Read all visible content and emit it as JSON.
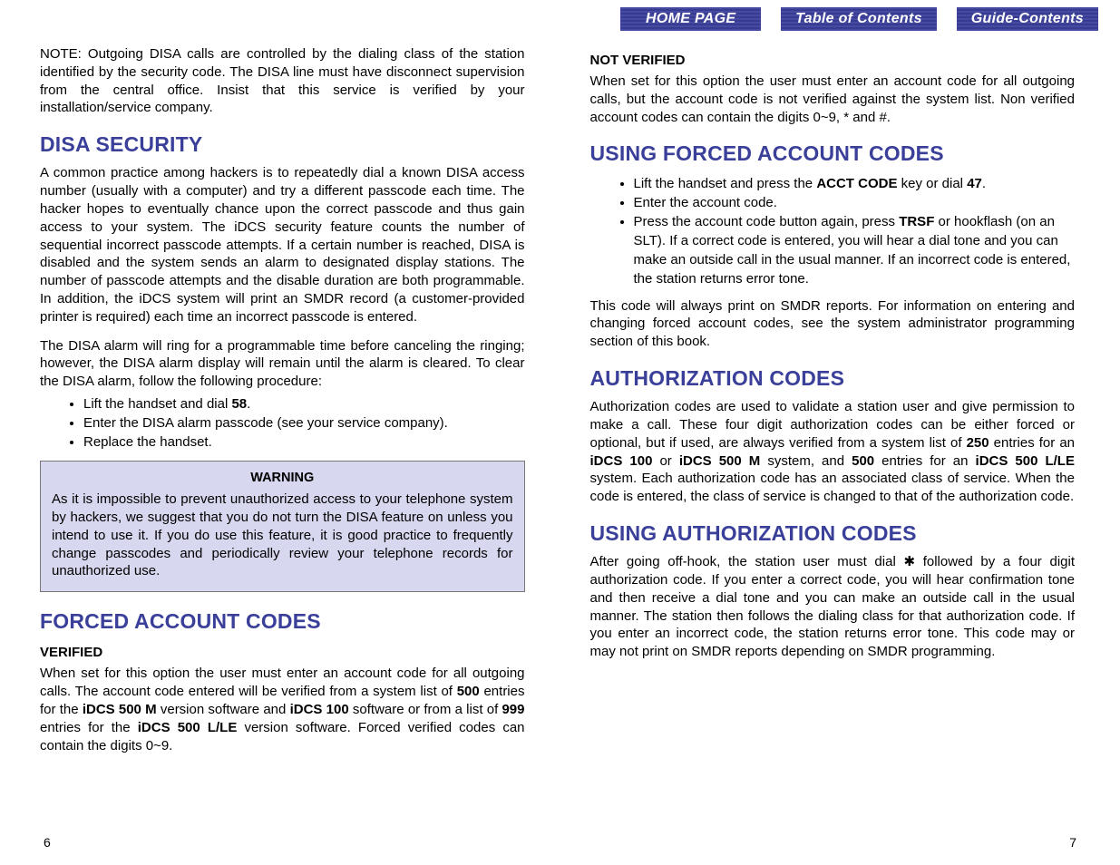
{
  "nav": {
    "home": "HOME PAGE",
    "toc": "Table of Contents",
    "guide": "Guide-Contents"
  },
  "left": {
    "note": "NOTE: Outgoing DISA calls are controlled by the dialing class of the station identified by the security code. The DISA line must have disconnect supervision from the central office. Insist that this service is verified by your installation/service company.",
    "h_disa": "DISA SECURITY",
    "disa_p1": "A common practice among hackers is to repeatedly dial a known DISA access number (usually with a computer) and try a different passcode each time. The hacker hopes to eventually chance upon the correct passcode and thus gain access to your system. The iDCS security feature counts the number of sequential incorrect passcode attempts. If a certain number is reached, DISA is disabled and the system sends an alarm to designated display stations. The number of passcode attempts and the disable duration are both programmable. In addition, the iDCS system will print an SMDR record (a customer-provided printer is required) each time an incorrect passcode is entered.",
    "disa_p2": "The DISA alarm will ring for a programmable time before canceling the ringing; however, the DISA alarm display will remain until the alarm is cleared. To clear the DISA alarm, follow the following procedure:",
    "disa_steps": {
      "s1a": "Lift the handset and dial ",
      "s1b": "58",
      "s1c": ".",
      "s2": "Enter the DISA alarm passcode (see your service company).",
      "s3": "Replace the handset."
    },
    "warn_title": "WARNING",
    "warn_body": "As it is impossible to prevent unauthorized access to your telephone system by hackers, we suggest that you do not turn the DISA feature on unless you intend to use it. If you do use this feature, it is good practice to frequently change passcodes and periodically review your telephone records for unauthorized use.",
    "h_forced": "FORCED ACCOUNT CODES",
    "h_verified": "VERIFIED",
    "verified_a": "When set for this option the user must enter an account code for all outgoing calls. The account code entered will be verified from a system list of ",
    "verified_b": "500",
    "verified_c": " entries for the ",
    "verified_d": "iDCS 500 M",
    "verified_e": " version software and ",
    "verified_f": "iDCS 100",
    "verified_g": " software or from a list of ",
    "verified_h": "999",
    "verified_i": " entries for the ",
    "verified_j": "iDCS 500 L/LE",
    "verified_k": " version software. Forced verified codes can contain the digits 0~9."
  },
  "right": {
    "h_notverified": "NOT VERIFIED",
    "notverified_p": "When set for this option the user must enter an account code for all outgoing calls, but the account code is not verified against the system list. Non verified account codes can contain the digits 0~9, * and #.",
    "h_usingforced": "USING FORCED ACCOUNT CODES",
    "uf_s1a": "Lift the handset and press the ",
    "uf_s1b": "ACCT CODE",
    "uf_s1c": " key or dial ",
    "uf_s1d": "47",
    "uf_s1e": ".",
    "uf_s2": "Enter the account code.",
    "uf_s3a": "Press the account code button again, press ",
    "uf_s3b": "TRSF",
    "uf_s3c": " or hookflash (on an SLT). If a correct code is entered, you will hear a dial tone and you can make an outside call in the usual manner. If an incorrect code is entered, the station returns error tone.",
    "uf_tail": "This code will always print on SMDR reports. For information on entering and changing forced account codes, see the system administrator programming section of this book.",
    "h_auth": "AUTHORIZATION CODES",
    "auth_a": "Authorization codes are used to validate a station user and give permission to make a call. These four digit authorization codes can be either forced or optional, but if used, are always verified from a system list of ",
    "auth_b": "250",
    "auth_c": " entries for an ",
    "auth_d": "iDCS 100",
    "auth_e": " or ",
    "auth_f": "iDCS 500 M",
    "auth_g": " system, and ",
    "auth_h": "500",
    "auth_i": " entries for an ",
    "auth_j": "iDCS 500 L/LE",
    "auth_k": " system. Each authorization code has an associated class of service. When the code is entered, the class of service is changed to that of the authorization code.",
    "h_usingauth": "USING AUTHORIZATION CODES",
    "usingauth_p": "After going off-hook, the station user must dial ✱ followed by a four digit authorization code. If you enter a correct code, you will hear confirmation tone and then receive a dial tone and you can make an outside call in the usual manner. The station then follows the dialing class for that authorization code. If you enter an incorrect code, the station returns error tone. This code may or may not print on SMDR reports depending on SMDR programming."
  },
  "pages": {
    "left": "6",
    "right": "7"
  }
}
